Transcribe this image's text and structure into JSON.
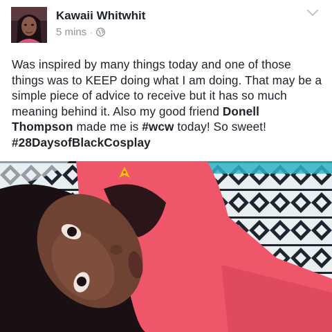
{
  "post": {
    "author": "Kawaii Whitwhit",
    "time": "5 mins",
    "separator": "·",
    "privacy_icon": "globe-icon",
    "menu_icon": "chevron-down-icon",
    "text_plain_1": "Was inspired by many things today and one of those things was to KEEP doing what I am doing. That may be a simple piece of advice to receive but it has so much meaning behind it. Also my good friend ",
    "tagged_friend": "Donell Thompson",
    "text_plain_2": " made me is ",
    "hashtag_1": "#wcw",
    "text_plain_3": " today! So sweet! ",
    "hashtag_2": "#28DaysofBlackCosplay"
  },
  "colors": {
    "text": "#1d2129",
    "meta": "#90949c",
    "shirt": "#f0566a",
    "insignia": "#f4c400",
    "blanket_dark": "#1c2430",
    "blanket_light": "#e9eef1"
  }
}
